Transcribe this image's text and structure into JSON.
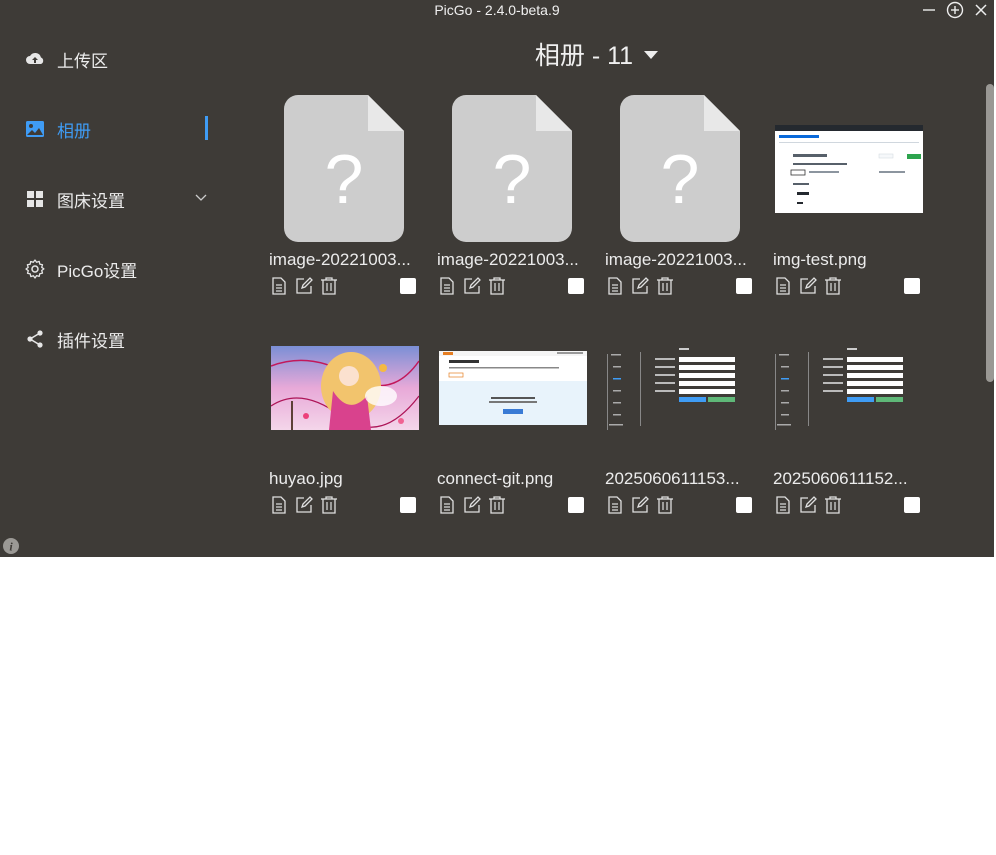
{
  "window": {
    "title": "PicGo - 2.4.0-beta.9"
  },
  "sidebar": {
    "items": [
      {
        "label": "上传区",
        "icon": "cloud-upload-icon"
      },
      {
        "label": "相册",
        "icon": "image-icon"
      },
      {
        "label": "图床设置",
        "icon": "grid-icon"
      },
      {
        "label": "PicGo设置",
        "icon": "gear-icon"
      },
      {
        "label": "插件设置",
        "icon": "share-icon"
      }
    ],
    "active": "相册"
  },
  "gallery": {
    "header": "相册 - 11",
    "cards": [
      {
        "name": "image-20221003...",
        "thumb": "placeholder"
      },
      {
        "name": "image-20221003...",
        "thumb": "placeholder"
      },
      {
        "name": "image-20221003...",
        "thumb": "placeholder"
      },
      {
        "name": "img-test.png",
        "thumb": "screenshot"
      },
      {
        "name": "huyao.jpg",
        "thumb": "illustration"
      },
      {
        "name": "connect-git.png",
        "thumb": "screenshot"
      },
      {
        "name": "2025060611153...",
        "thumb": "settings-screenshot"
      },
      {
        "name": "2025060611152...",
        "thumb": "settings-screenshot"
      }
    ]
  },
  "colors": {
    "background": "#3e3b37",
    "accent": "#3f9cf5",
    "text": "#ececec"
  }
}
